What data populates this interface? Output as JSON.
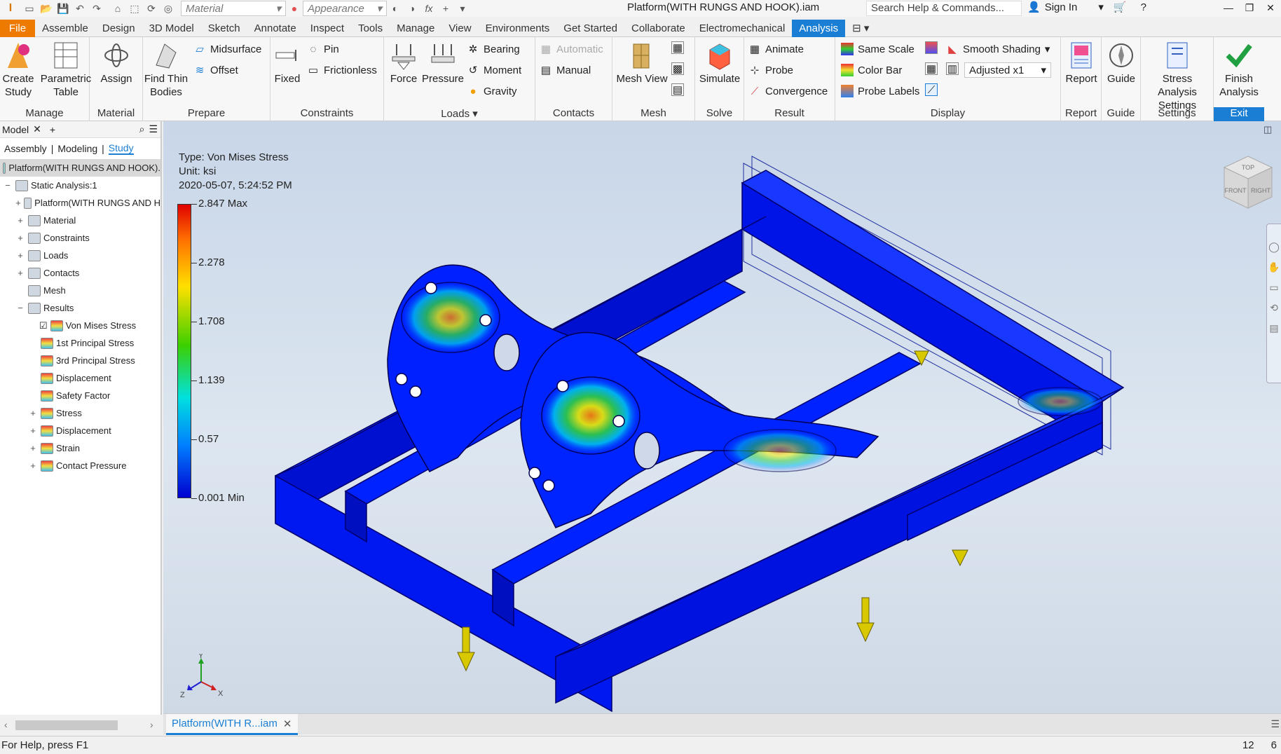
{
  "qat": {
    "logo": "I",
    "material_placeholder": "Material",
    "appearance_placeholder": "Appearance",
    "fx": "fx"
  },
  "window": {
    "title": "Platform(WITH RUNGS AND HOOK).iam",
    "search": "Search Help & Commands...",
    "signin": "Sign In"
  },
  "tabs": [
    "File",
    "Assemble",
    "Design",
    "3D Model",
    "Sketch",
    "Annotate",
    "Inspect",
    "Tools",
    "Manage",
    "View",
    "Environments",
    "Get Started",
    "Collaborate",
    "Electromechanical",
    "Analysis"
  ],
  "ribbon": {
    "manage": {
      "title": "Manage",
      "create_study": "Create Study",
      "parametric_table": "Parametric Table"
    },
    "material": {
      "title": "Material",
      "assign": "Assign"
    },
    "prepare": {
      "title": "Prepare",
      "find_thin": "Find Thin Bodies",
      "midsurface": "Midsurface",
      "offset": "Offset"
    },
    "constraints": {
      "title": "Constraints",
      "fixed": "Fixed",
      "pin": "Pin",
      "frictionless": "Frictionless"
    },
    "loads": {
      "title": "Loads",
      "force": "Force",
      "pressure": "Pressure",
      "bearing": "Bearing",
      "moment": "Moment",
      "gravity": "Gravity"
    },
    "contacts": {
      "title": "Contacts",
      "automatic": "Automatic",
      "manual": "Manual"
    },
    "mesh": {
      "title": "Mesh",
      "mesh_view": "Mesh View"
    },
    "solve": {
      "title": "Solve",
      "simulate": "Simulate"
    },
    "result": {
      "title": "Result",
      "animate": "Animate",
      "probe": "Probe",
      "convergence": "Convergence"
    },
    "display": {
      "title": "Display",
      "same_scale": "Same Scale",
      "color_bar": "Color Bar",
      "probe_labels": "Probe Labels",
      "smooth_shading": "Smooth Shading",
      "adjusted": "Adjusted x1"
    },
    "report": {
      "title": "Report",
      "report": "Report"
    },
    "guide": {
      "title": "Guide",
      "guide": "Guide"
    },
    "settings": {
      "title": "Settings",
      "stress_settings": "Stress Analysis Settings"
    },
    "exit": {
      "title": "Exit",
      "finish": "Finish Analysis"
    }
  },
  "browser": {
    "header": "Model",
    "tabs": [
      "Assembly",
      "Modeling",
      "Study"
    ],
    "root": "Platform(WITH RUNGS AND HOOK).",
    "nodes": [
      {
        "label": "Static Analysis:1",
        "exp": "−",
        "indent": 0
      },
      {
        "label": "Platform(WITH RUNGS AND H",
        "exp": "+",
        "indent": 1
      },
      {
        "label": "Material",
        "exp": "+",
        "indent": 1
      },
      {
        "label": "Constraints",
        "exp": "+",
        "indent": 1
      },
      {
        "label": "Loads",
        "exp": "+",
        "indent": 1
      },
      {
        "label": "Contacts",
        "exp": "+",
        "indent": 1
      },
      {
        "label": "Mesh",
        "exp": "",
        "indent": 1
      },
      {
        "label": "Results",
        "exp": "−",
        "indent": 1
      },
      {
        "label": "Von Mises Stress",
        "exp": "",
        "indent": 2,
        "checked": true
      },
      {
        "label": "1st Principal Stress",
        "exp": "",
        "indent": 2
      },
      {
        "label": "3rd Principal Stress",
        "exp": "",
        "indent": 2
      },
      {
        "label": "Displacement",
        "exp": "",
        "indent": 2
      },
      {
        "label": "Safety Factor",
        "exp": "",
        "indent": 2
      },
      {
        "label": "Stress",
        "exp": "+",
        "indent": 2
      },
      {
        "label": "Displacement",
        "exp": "+",
        "indent": 2
      },
      {
        "label": "Strain",
        "exp": "+",
        "indent": 2
      },
      {
        "label": "Contact Pressure",
        "exp": "+",
        "indent": 2
      }
    ]
  },
  "viewport": {
    "type": "Type: Von Mises Stress",
    "unit": "Unit: ksi",
    "date": "2020-05-07, 5:24:52 PM",
    "legend": [
      {
        "label": "2.847 Max",
        "f": 0
      },
      {
        "label": "2.278",
        "f": 0.2
      },
      {
        "label": "1.708",
        "f": 0.4
      },
      {
        "label": "1.139",
        "f": 0.6
      },
      {
        "label": "0.57",
        "f": 0.8
      },
      {
        "label": "0.001 Min",
        "f": 1
      }
    ],
    "viewcube": {
      "top": "TOP",
      "front": "FRONT",
      "right": "RIGHT"
    },
    "triad": {
      "x": "X",
      "y": "Y",
      "z": "Z"
    }
  },
  "doc_tab": "Platform(WITH R...iam",
  "status": {
    "help": "For Help, press F1",
    "n1": "12",
    "n2": "6"
  }
}
